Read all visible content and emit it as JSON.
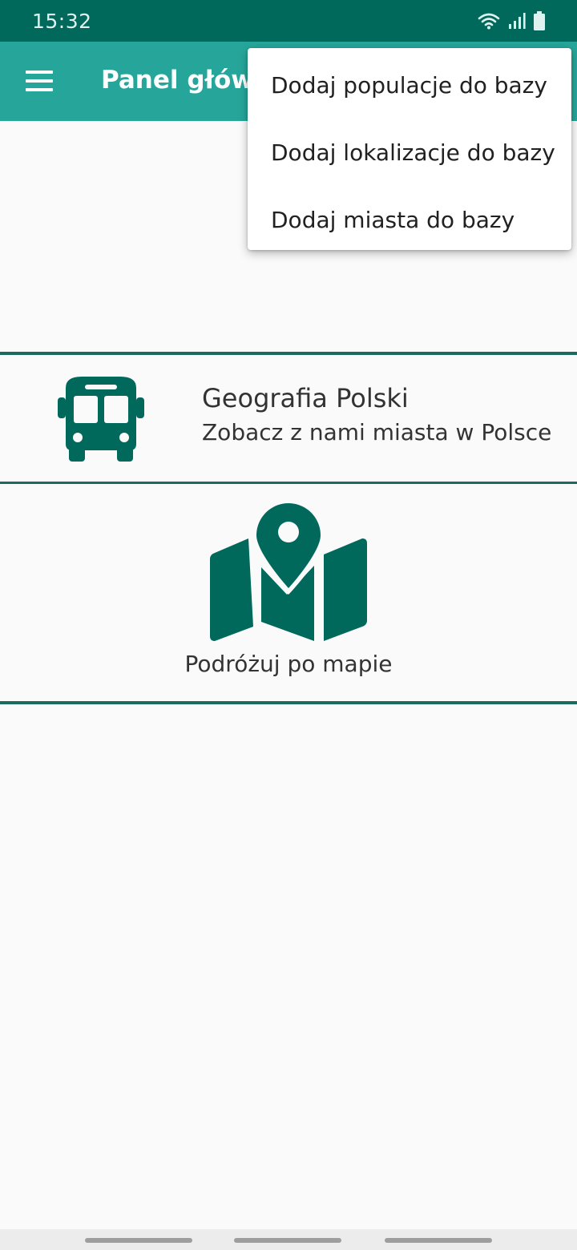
{
  "status_bar": {
    "time": "15:32",
    "icons": [
      "wifi-icon",
      "signal-icon",
      "battery-icon"
    ]
  },
  "app_bar": {
    "title": "Panel główny",
    "menu_icon": "menu-icon"
  },
  "popup_menu": {
    "items": [
      {
        "label": "Dodaj populacje do bazy"
      },
      {
        "label": "Dodaj lokalizacje do bazy"
      },
      {
        "label": "Dodaj miasta do bazy"
      }
    ]
  },
  "cards": {
    "geography": {
      "icon": "bus-icon",
      "title": "Geografia Polski",
      "subtitle": "Zobacz z nami miasta w Polsce"
    },
    "map": {
      "icon": "map-pin-icon",
      "label": "Podróżuj po mapie"
    }
  },
  "colors": {
    "status_bar": "#00695c",
    "app_bar": "#26a69a",
    "accent": "#00695c",
    "divider": "#1b6b60",
    "background": "#fafafa"
  }
}
